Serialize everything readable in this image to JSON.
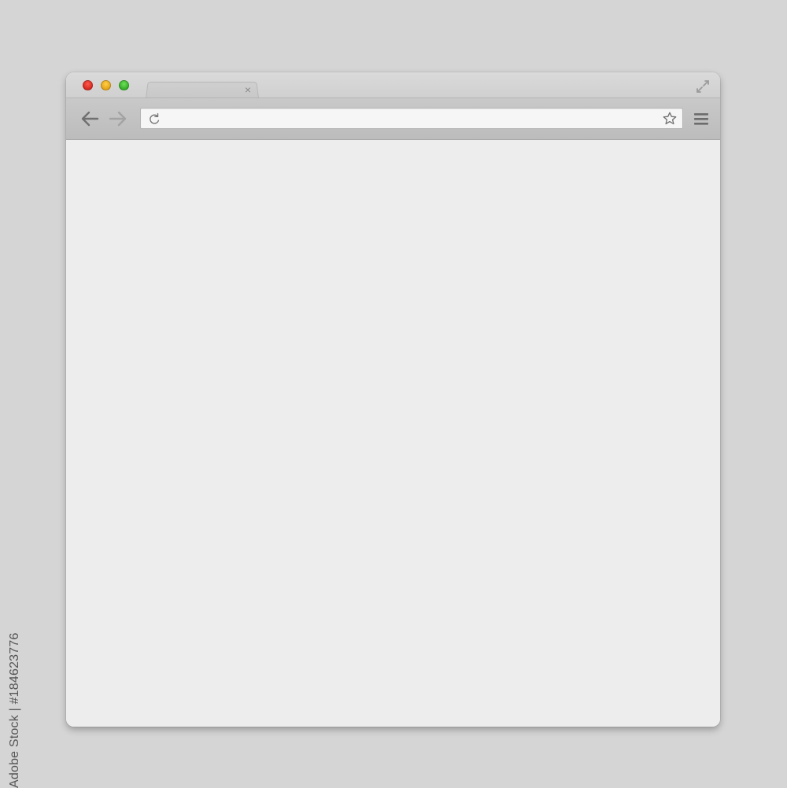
{
  "browser": {
    "window_controls": [
      "close",
      "minimize",
      "zoom"
    ],
    "tab": {
      "title": "",
      "close_glyph": "×"
    },
    "toolbar": {
      "back_icon": "back-arrow-icon",
      "forward_icon": "forward-arrow-icon",
      "reload_icon": "reload-icon",
      "bookmark_icon": "star-icon",
      "menu_icon": "hamburger-menu-icon"
    },
    "address_bar": {
      "value": "",
      "placeholder": ""
    },
    "fullscreen_icon": "fullscreen-icon"
  },
  "watermark": {
    "text": "Adobe Stock | #184623776"
  },
  "colors": {
    "close": "#e0291f",
    "minimize": "#f0a800",
    "zoom": "#35b92a",
    "page_background": "#ededed",
    "toolbar": "#c3c3c3"
  }
}
